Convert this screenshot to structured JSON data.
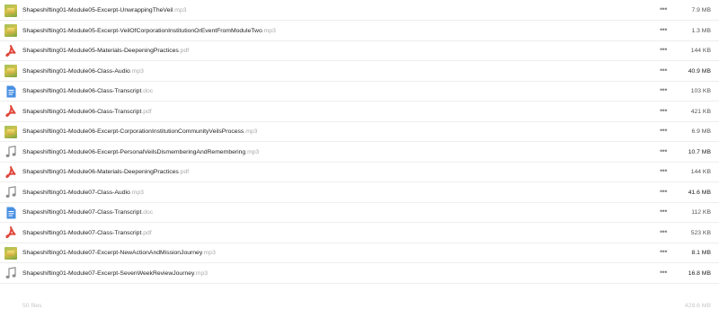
{
  "files": [
    {
      "base": "Shapeshifting01-Module05-Excerpt-UnwrappingTheVeil",
      "ext": ".mp3",
      "size": "7.9 MB",
      "icon": "image-thumbnail-icon"
    },
    {
      "base": "Shapeshifting01-Module05-Excerpt-VeilOfCorporationInstitutionOrEventFromModuleTwo",
      "ext": ".mp3",
      "size": "1.3 MB",
      "icon": "image-thumbnail-icon"
    },
    {
      "base": "Shapeshifting01-Module05-Materials-DeepeningPractices",
      "ext": ".pdf",
      "size": "144 KB",
      "icon": "pdf-icon"
    },
    {
      "base": "Shapeshifting01-Module06-Class-Audio",
      "ext": ".mp3",
      "size": "40.9 MB",
      "icon": "image-thumbnail-icon"
    },
    {
      "base": "Shapeshifting01-Module06-Class-Transcript",
      "ext": ".doc",
      "size": "103 KB",
      "icon": "document-icon"
    },
    {
      "base": "Shapeshifting01-Module06-Class-Transcript",
      "ext": ".pdf",
      "size": "421 KB",
      "icon": "pdf-icon"
    },
    {
      "base": "Shapeshifting01-Module06-Excerpt-CorporationInstitutionCommunityVeilsProcess",
      "ext": ".mp3",
      "size": "6.9 MB",
      "icon": "image-thumbnail-icon"
    },
    {
      "base": "Shapeshifting01-Module06-Excerpt-PersonalVeilsDismemberingAndRemembering",
      "ext": ".mp3",
      "size": "10.7 MB",
      "icon": "music-note-icon"
    },
    {
      "base": "Shapeshifting01-Module06-Materials-DeepeningPractices",
      "ext": ".pdf",
      "size": "144 KB",
      "icon": "pdf-icon"
    },
    {
      "base": "Shapeshifting01-Module07-Class-Audio",
      "ext": ".mp3",
      "size": "41.6 MB",
      "icon": "music-note-icon"
    },
    {
      "base": "Shapeshifting01-Module07-Class-Transcript",
      "ext": ".doc",
      "size": "112 KB",
      "icon": "document-icon"
    },
    {
      "base": "Shapeshifting01-Module07-Class-Transcript",
      "ext": ".pdf",
      "size": "523 KB",
      "icon": "pdf-icon"
    },
    {
      "base": "Shapeshifting01-Module07-Excerpt-NewActionAndMissionJourney",
      "ext": ".mp3",
      "size": "8.1 MB",
      "icon": "image-thumbnail-icon"
    },
    {
      "base": "Shapeshifting01-Module07-Excerpt-SevenWeekReviewJourney",
      "ext": ".mp3",
      "size": "16.8 MB",
      "icon": "music-note-icon"
    }
  ],
  "more_label": "•••",
  "summary": {
    "count": "50 files",
    "total": "428.6 MB"
  },
  "colors": {
    "pdf": "#e0473b",
    "doc": "#4a90e2",
    "music": "#8c8c8c"
  }
}
